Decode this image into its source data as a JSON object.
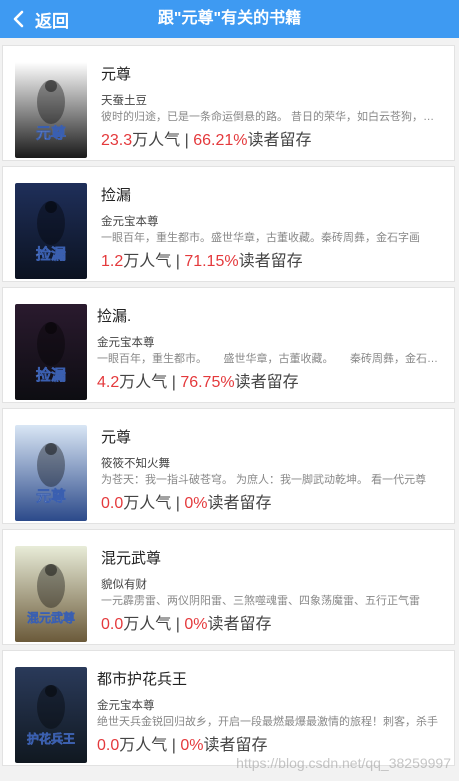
{
  "header": {
    "back_label": "返回",
    "title": "跟\"元尊\"有关的书籍"
  },
  "labels": {
    "popularity_unit": "万人气",
    "separator": " | ",
    "retention_suffix": "读者留存"
  },
  "books": [
    {
      "title": "元尊",
      "author": "天蚕土豆",
      "desc": "彼时的归途，已是一条命运倒悬的路。 昔日的荣华，如白云苍狗，恐大梦一场",
      "popularity": "23.3",
      "retention": "66.21%",
      "cover_text": "元尊",
      "cover_colors": [
        "#ffffff",
        "#1a1a1a"
      ]
    },
    {
      "title": "捡漏",
      "author": "金元宝本尊",
      "desc": "一眼百年，重生都市。盛世华章，古董收藏。秦砖周彝，金石字画",
      "popularity": "1.2",
      "retention": "71.15%",
      "cover_text": "捡漏",
      "cover_colors": [
        "#1f2f5a",
        "#0b1220"
      ]
    },
    {
      "title": "捡漏.",
      "author": "金元宝本尊",
      "desc": "一眼百年，重生都市。　　盛世华章，古董收藏。　　秦砖周彝，金石字画",
      "popularity": "4.2",
      "retention": "76.75%",
      "cover_text": "捡漏",
      "cover_colors": [
        "#2a1a2e",
        "#0d0d12"
      ]
    },
    {
      "title": "元尊",
      "author": "筱筱不知火舞",
      "desc": "为苍天：我一指斗破苍穹。 为庶人：我一脚武动乾坤。 看一代元尊",
      "popularity": "0.0",
      "retention": "0%",
      "cover_text": "元尊",
      "cover_colors": [
        "#d9e6f5",
        "#2c4a8a"
      ]
    },
    {
      "title": "混元武尊",
      "author": "貌似有财",
      "desc": "一元霹雳雷、两仪阴阳雷、三煞噬魂雷、四象荡魔雷、五行正气雷",
      "popularity": "0.0",
      "retention": "0%",
      "cover_text": "混元武尊",
      "cover_colors": [
        "#e8ecd8",
        "#6b5a3a"
      ]
    },
    {
      "title": "都市护花兵王",
      "author": "金元宝本尊",
      "desc": "绝世天兵金锐回归故乡，开启一段最燃最爆最激情的旅程！刺客，杀手",
      "popularity": "0.0",
      "retention": "0%",
      "cover_text": "护花兵王",
      "cover_colors": [
        "#2a3a5a",
        "#101820"
      ]
    }
  ],
  "watermark": "https://blog.csdn.net/qq_38259997"
}
